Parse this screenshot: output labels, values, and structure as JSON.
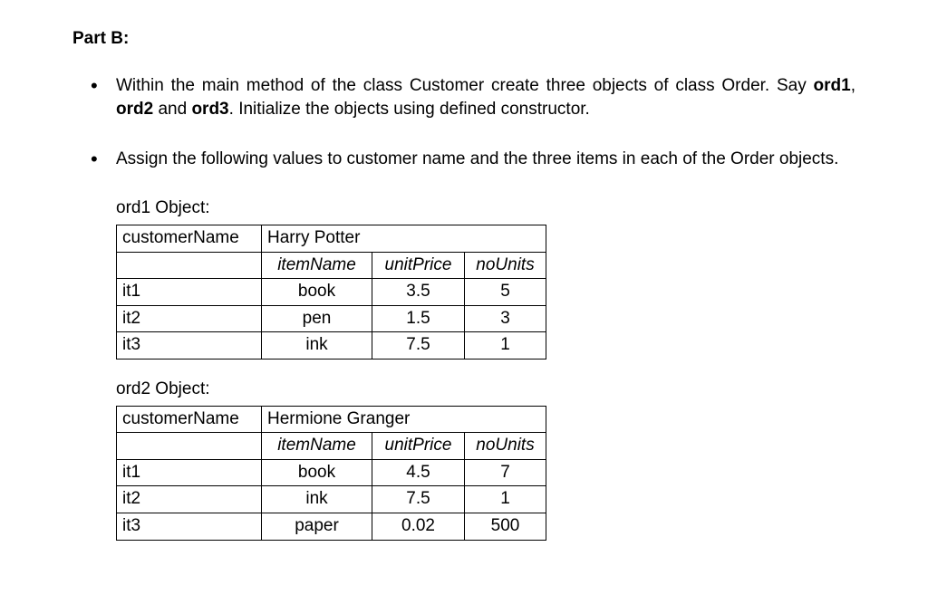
{
  "heading": "Part B:",
  "bullet1_pre": "Within the main method of the class Customer create three objects of class Order. Say ",
  "bullet1_b1": "ord1",
  "bullet1_sep1": ", ",
  "bullet1_b2": "ord2",
  "bullet1_sep2": " and ",
  "bullet1_b3": "ord3",
  "bullet1_post": ". Initialize the objects using defined constructor.",
  "bullet2": "Assign the following values to customer name and the three items in each of the Order objects.",
  "labels": {
    "customerName": "customerName",
    "itemName": "itemName",
    "unitPrice": "unitPrice",
    "noUnits": "noUnits",
    "it1": "it1",
    "it2": "it2",
    "it3": "it3"
  },
  "ord1": {
    "title": "ord1 Object:",
    "customerName": "Harry Potter",
    "items": [
      {
        "name": "book",
        "unitPrice": "3.5",
        "noUnits": "5"
      },
      {
        "name": "pen",
        "unitPrice": "1.5",
        "noUnits": "3"
      },
      {
        "name": "ink",
        "unitPrice": "7.5",
        "noUnits": "1"
      }
    ]
  },
  "ord2": {
    "title": "ord2 Object:",
    "customerName": "Hermione Granger",
    "items": [
      {
        "name": "book",
        "unitPrice": "4.5",
        "noUnits": "7"
      },
      {
        "name": "ink",
        "unitPrice": "7.5",
        "noUnits": "1"
      },
      {
        "name": "paper",
        "unitPrice": "0.02",
        "noUnits": "500"
      }
    ]
  }
}
